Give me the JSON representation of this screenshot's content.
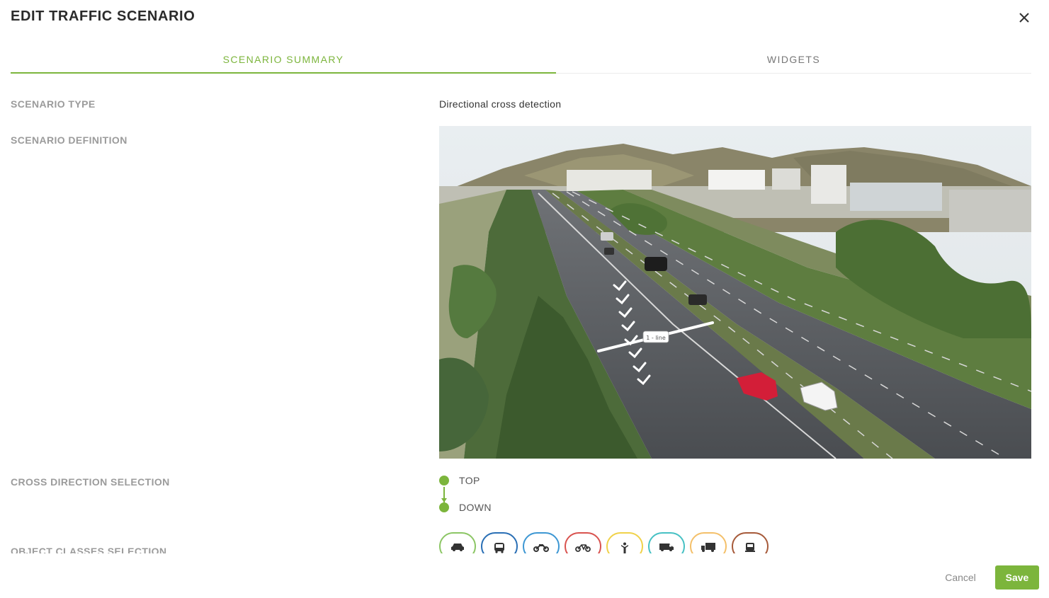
{
  "dialog": {
    "title": "EDIT TRAFFIC SCENARIO",
    "close_icon": "close-icon"
  },
  "tabs": [
    {
      "label": "SCENARIO SUMMARY",
      "active": true
    },
    {
      "label": "WIDGETS",
      "active": false
    }
  ],
  "summary": {
    "scenario_type_label": "SCENARIO TYPE",
    "scenario_type_value": "Directional cross detection",
    "scenario_definition_label": "SCENARIO DEFINITION",
    "line_tag": "1 - line",
    "cross_direction_label": "CROSS DIRECTION SELECTION",
    "directions": [
      "TOP",
      "DOWN"
    ],
    "object_classes_label": "OBJECT CLASSES SELECTION",
    "object_classes": [
      {
        "icon": "car-icon",
        "color": "#8cc665"
      },
      {
        "icon": "bus-icon",
        "color": "#2a6fb5"
      },
      {
        "icon": "motorcycle-icon",
        "color": "#3d97d3"
      },
      {
        "icon": "bicycle-icon",
        "color": "#d9534f"
      },
      {
        "icon": "pedestrian-icon",
        "color": "#f0d24a"
      },
      {
        "icon": "van-icon",
        "color": "#47c1c4"
      },
      {
        "icon": "truck-icon",
        "color": "#f4c06a"
      },
      {
        "icon": "heavy-truck-icon",
        "color": "#a65a3a"
      }
    ]
  },
  "footer": {
    "cancel_label": "Cancel",
    "save_label": "Save"
  },
  "colors": {
    "accent": "#7cb53c",
    "label_gray": "#9b9b9b"
  }
}
